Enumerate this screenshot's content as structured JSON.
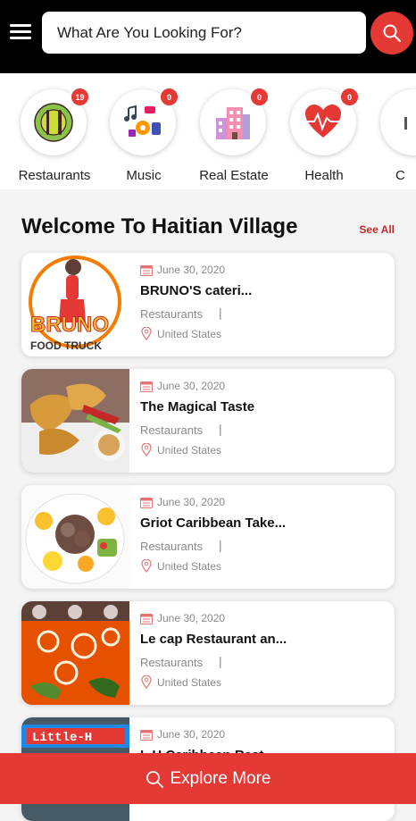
{
  "search": {
    "placeholder": "What Are You Looking For?"
  },
  "categories": [
    {
      "label": "Restaurants",
      "badge": "19",
      "icon": "restaurant-icon"
    },
    {
      "label": "Music",
      "badge": "0",
      "icon": "music-icon"
    },
    {
      "label": "Real Estate",
      "badge": "0",
      "icon": "building-icon"
    },
    {
      "label": "Health",
      "badge": "0",
      "icon": "heartbeat-icon"
    },
    {
      "label": "C",
      "badge": "",
      "icon": "category-icon"
    }
  ],
  "section": {
    "title": "Welcome To Haitian Village",
    "see_all": "See All"
  },
  "listings": [
    {
      "date": "June 30, 2020",
      "title": "BRUNO'S cateri...",
      "category": "Restaurants",
      "separator": "|",
      "location": "United States",
      "image": "bruno-food-truck-logo"
    },
    {
      "date": "June 30, 2020",
      "title": "The Magical Taste",
      "category": "Restaurants",
      "separator": "|",
      "location": "United States",
      "image": "fried-pastries-photo"
    },
    {
      "date": "June 30, 2020",
      "title": "Griot Caribbean Take...",
      "category": "Restaurants",
      "separator": "|",
      "location": "United States",
      "image": "griot-plate-photo"
    },
    {
      "date": "June 30, 2020",
      "title": "Le cap Restaurant an...",
      "category": "Restaurants",
      "separator": "|",
      "location": "United States",
      "image": "soup-photo"
    },
    {
      "date": "June 30, 2020",
      "title": "L.H Caribbean Rest...",
      "category": "",
      "separator": "",
      "location": "",
      "image": "little-haiti-sign-photo"
    }
  ],
  "explore": {
    "label": "Explore More"
  },
  "colors": {
    "accent": "#e53935",
    "header": "#000000",
    "muted": "#8a8a8a"
  }
}
